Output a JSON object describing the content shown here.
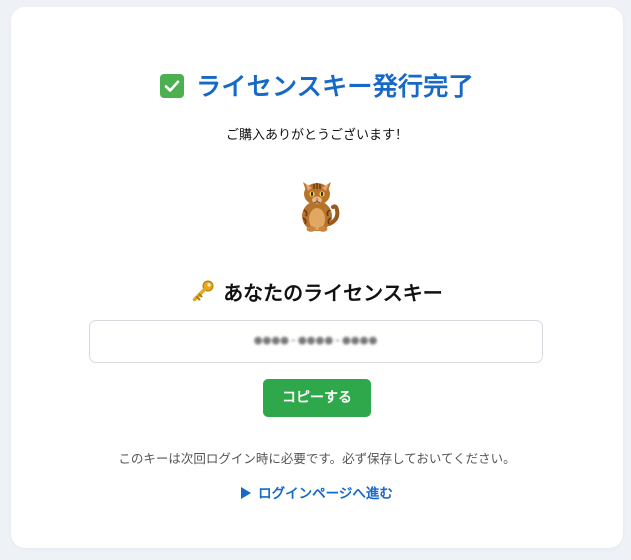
{
  "header": {
    "title": "ライセンスキー発行完了",
    "subtitle": "ご購入ありがとうございます！"
  },
  "license": {
    "heading": "あなたのライセンスキー",
    "key_value": "●●●●-●●●●-●●●●"
  },
  "actions": {
    "copy_label": "コピーする",
    "note": "このキーは次回ログイン時に必要です。必ず保存しておいてください。",
    "login_link": "ログインページへ進む"
  },
  "icons": {
    "title_icon": "check-mark-icon",
    "mascot": "cat-icon",
    "key_icon": "key-icon",
    "link_icon": "play-triangle-icon"
  },
  "colors": {
    "accent": "#1769c8",
    "button": "#2ea84a",
    "check": "#4caf50"
  }
}
